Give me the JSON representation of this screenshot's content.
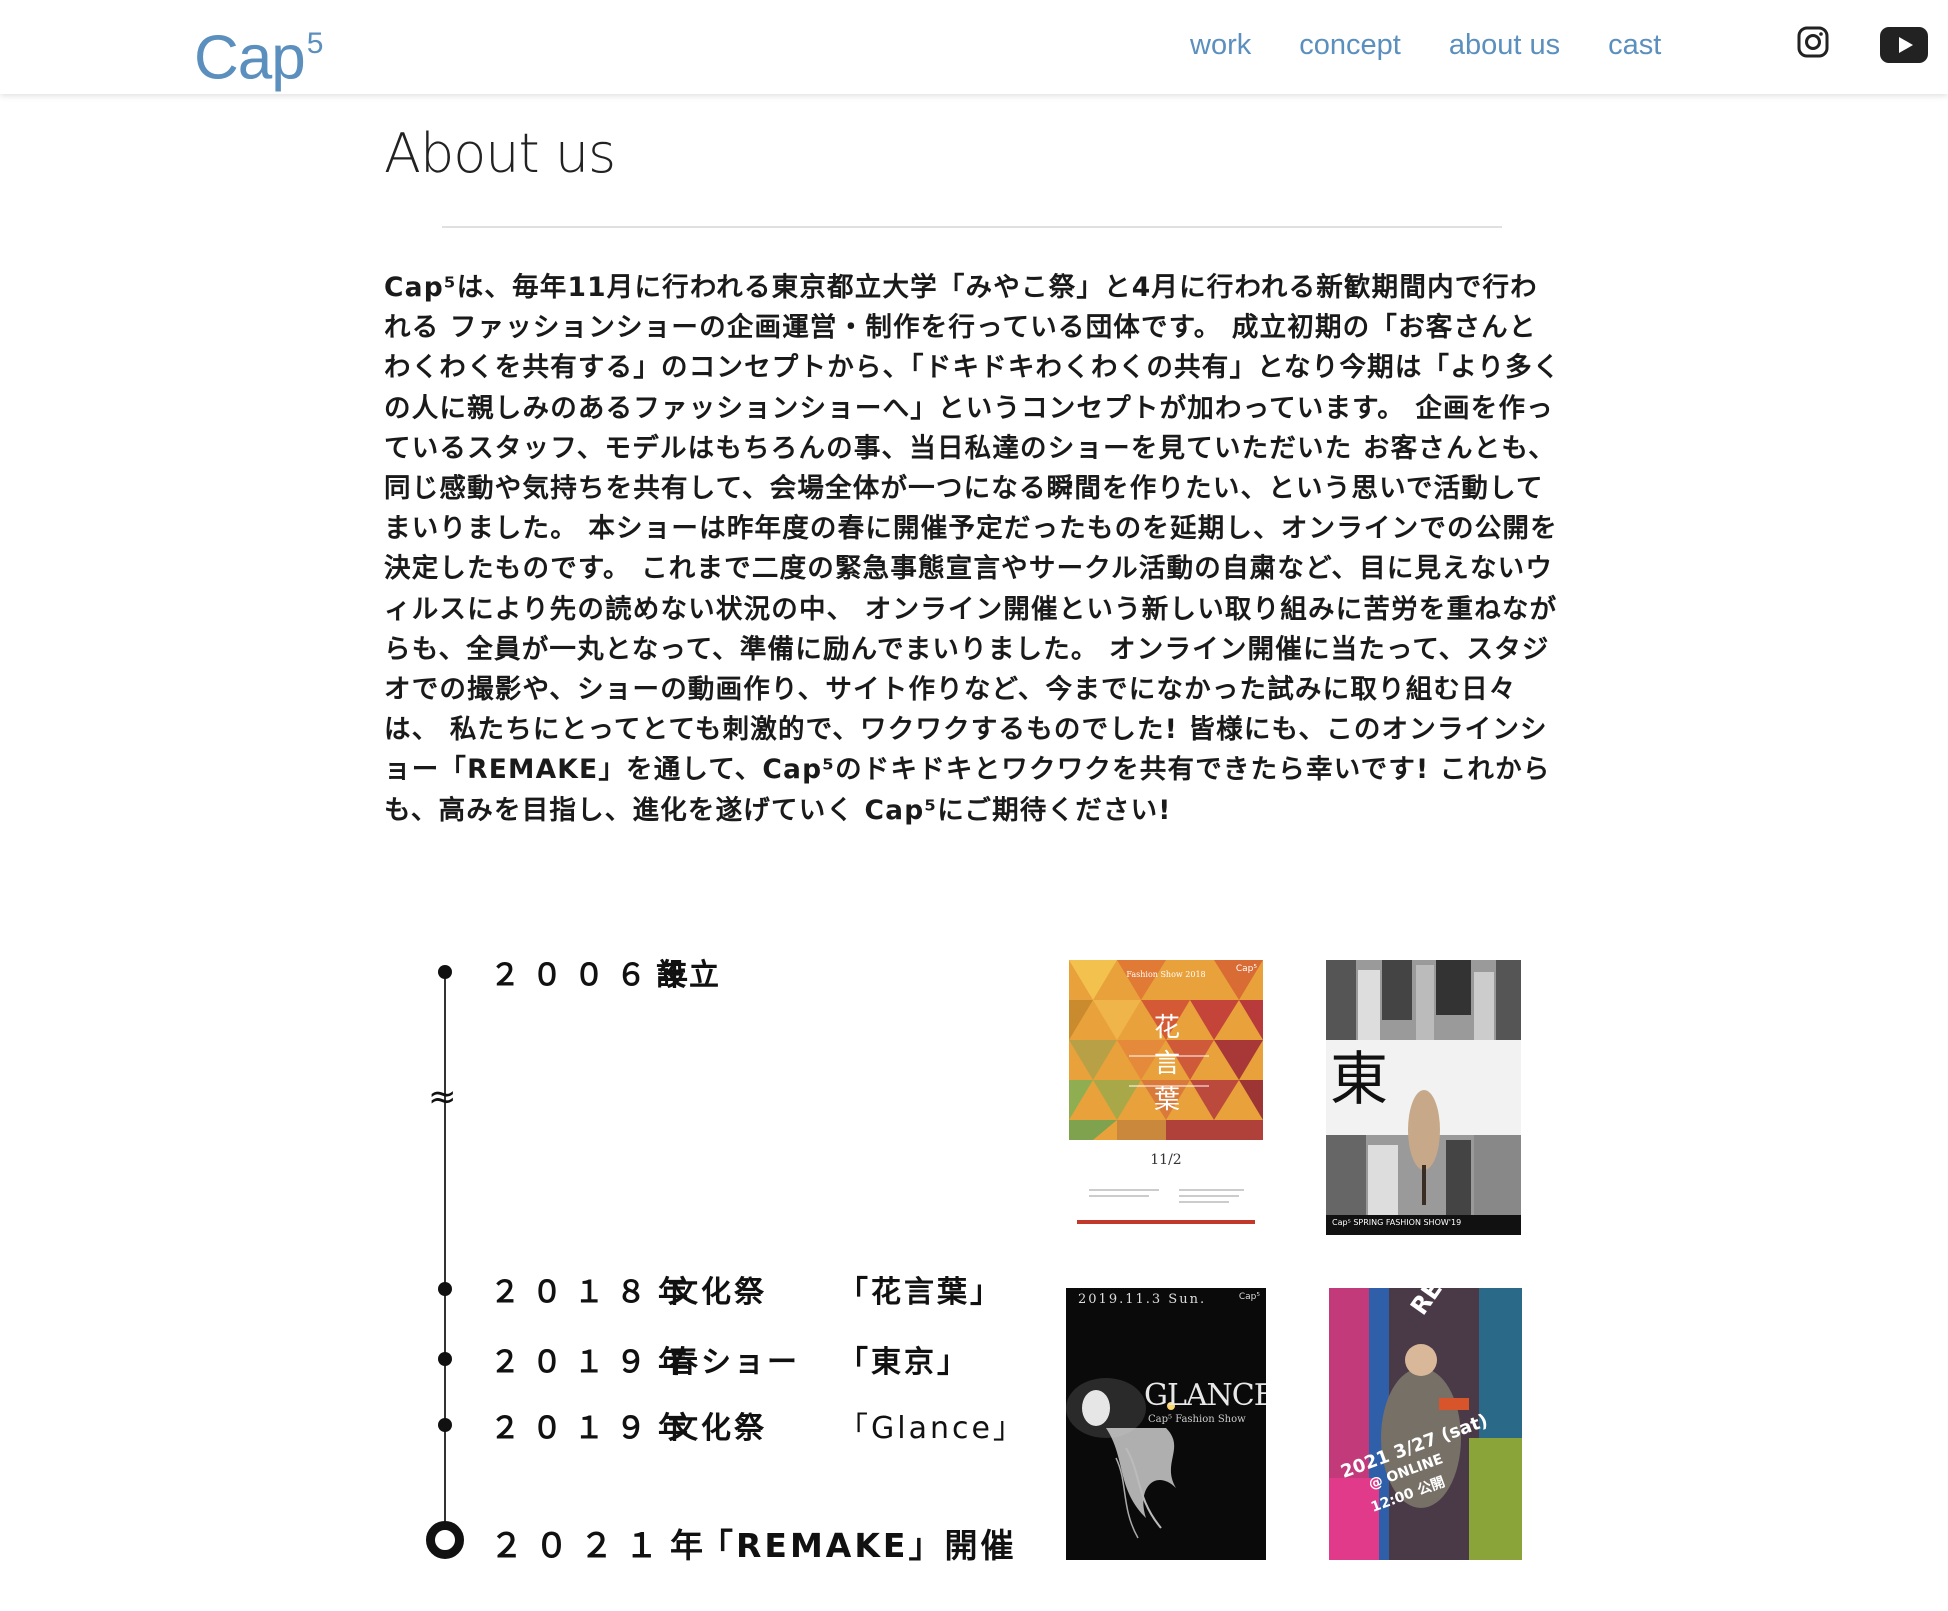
{
  "header": {
    "logo_text": "Cap",
    "logo_sup": "5",
    "nav": [
      "work",
      "concept",
      "about us",
      "cast"
    ],
    "social": [
      "instagram-icon",
      "youtube-icon"
    ],
    "accent_color": "#5b8fbd"
  },
  "page": {
    "title": "About us",
    "intro": "Cap⁵は、毎年11月に行われる東京都立大学「みやこ祭」と4月に行われる新歓期間内で行われる ファッションショーの企画運営・制作を行っている団体です。 成立初期の「お客さんとわくわくを共有する」のコンセプトから、「ドキドキわくわくの共有」となり今期は「より多くの人に親しみのあるファッションショーへ」というコンセプトが加わっています。 企画を作っているスタッフ、モデルはもちろんの事、当日私達のショーを見ていただいた お客さんとも、同じ感動や気持ちを共有して、会場全体が一つになる瞬間を作りたい、という思いで活動してまいりました。 本ショーは昨年度の春に開催予定だったものを延期し、オンラインでの公開を決定したものです。 これまで二度の緊急事態宣言やサークル活動の自粛など、目に見えないウィルスにより先の読めない状況の中、 オンライン開催という新しい取り組みに苦労を重ねながらも、全員が一丸となって、準備に励んでまいりました。 オンライン開催に当たって、スタジオでの撮影や、ショーの動画作り、サイト作りなど、今までになかった試みに取り組む日々は、 私たちにとってとても刺激的で、ワクワクするものでした! 皆様にも、このオンラインショー「REMAKE」を通して、Cap⁵のドキドキとワクワクを共有できたら幸いです! これからも、高みを目指し、進化を遂げていく Cap⁵にご期待ください!"
  },
  "timeline": {
    "gap_symbol": "≈",
    "events": [
      {
        "year": "２００６年",
        "event": "設立",
        "title": ""
      },
      {
        "year": "２０１８年",
        "event": "文化祭",
        "title": "「花言葉」"
      },
      {
        "year": "２０１９年",
        "event": "春ショー",
        "title": "「東京」"
      },
      {
        "year": "２０１９年",
        "event": "文化祭",
        "title": "「Glance」"
      },
      {
        "year": "２０２１年",
        "event": "「REMAKE」開催",
        "title": ""
      }
    ]
  },
  "posters": {
    "p1": {
      "kana": "花\n言\n葉",
      "top": "Fashion Show 2018",
      "logo": "Cap⁵",
      "date": "11/2",
      "colors": [
        "#e9a23b",
        "#d96b34",
        "#c4443a",
        "#8fae52",
        "#f2c14e"
      ]
    },
    "p2": {
      "kana": "東　京",
      "bottom": "Cap⁵ SPRING FASHION SHOW'19",
      "logo": "Cap⁵"
    },
    "p3": {
      "date": "2019.11.3 Sun.",
      "logo": "Cap⁵",
      "title": "GLANCE",
      "sub": "Cap⁵ Fashion Show"
    },
    "p4": {
      "title": "REMAKE",
      "date_line": "2021 3/27 (sat)",
      "online": "@ ONLINE",
      "time": "12:00 公開"
    }
  }
}
